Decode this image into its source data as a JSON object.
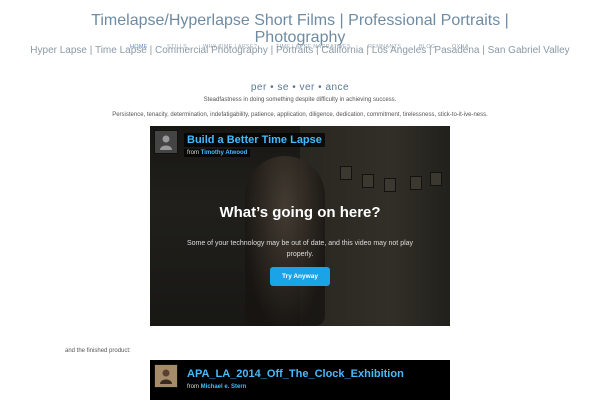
{
  "site": {
    "title": "Timelapse/Hyperlapse Short Films | Professional Portraits | Photography",
    "tagline": "Hyper Lapse | Time Lapse | Commercial Photography | Portraits | California | Los Angeles | Pasadena | San Gabriel Valley"
  },
  "nav": {
    "items": [
      {
        "label": "Home",
        "active": true
      },
      {
        "label": "Stills",
        "active": false
      },
      {
        "label": "Why Time Lapse?",
        "active": false
      },
      {
        "label": "Time Lapse Narratives",
        "active": false
      },
      {
        "label": "Remnants",
        "active": false
      },
      {
        "label": "Blog",
        "active": false
      },
      {
        "label": "Oxna",
        "active": false
      }
    ]
  },
  "intro": {
    "word": "per • se • ver • ance",
    "definition": "Steadfastness in doing something despite difficulty in achieving success.",
    "synonyms": "Persistence, tenacity, determination, indefatigability, patience, application, diligence, dedication, commitment, tirelessness, stick-to-it-ive-ness."
  },
  "video1": {
    "title": "Build a Better Time Lapse",
    "from_prefix": "from",
    "author": "Timothy Atwood",
    "message_title": "What’s going on here?",
    "message_body": "Some of your technology may be out of date, and this video may not play properly.",
    "button_label": "Try Anyway"
  },
  "finished_text": "and the finished product:",
  "video2": {
    "title": "APA_LA_2014_Off_The_Clock_Exhibition",
    "from_prefix": "from",
    "author": "Michael e. Stern"
  },
  "colors": {
    "title": "#6f8ba3",
    "nav_active": "#5b88c0",
    "player_accent": "#44bbff",
    "button": "#1aa3e6"
  }
}
